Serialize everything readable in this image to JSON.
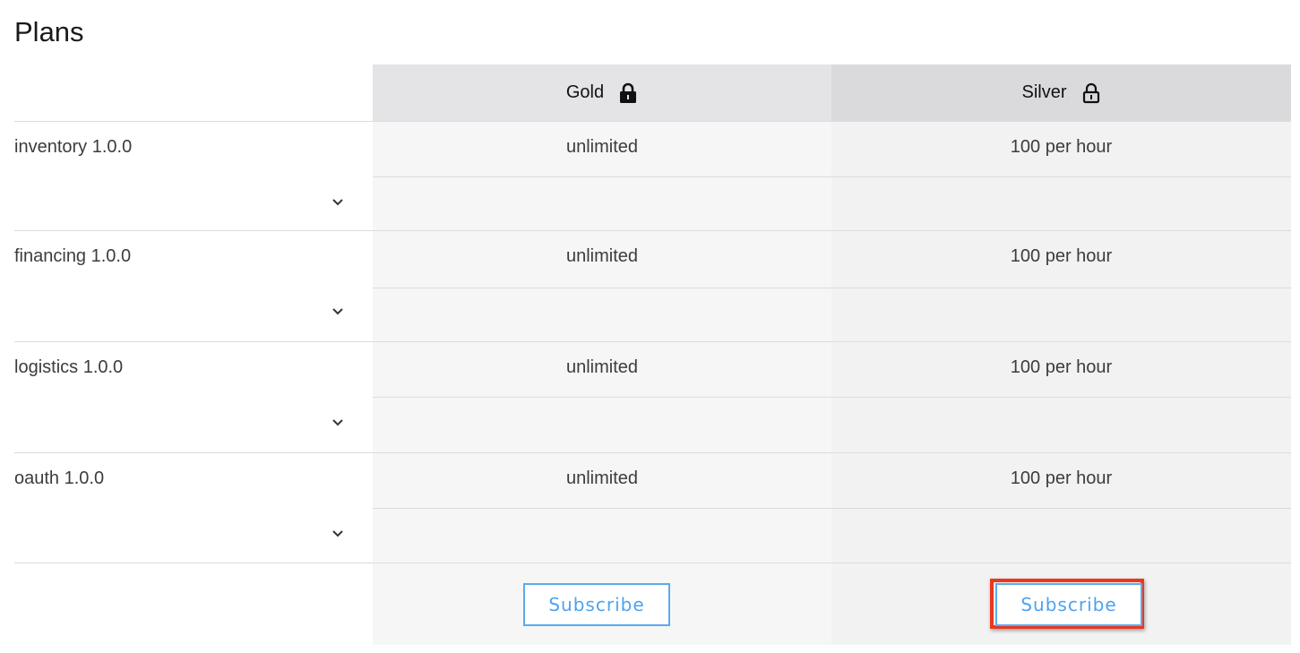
{
  "page": {
    "title": "Plans"
  },
  "plans": [
    {
      "name": "Gold",
      "lock_icon": "lock-closed-icon",
      "subscribe_label": "Subscribe"
    },
    {
      "name": "Silver",
      "lock_icon": "lock-open-icon",
      "subscribe_label": "Subscribe"
    }
  ],
  "apis": [
    {
      "name": "inventory 1.0.0",
      "gold": "unlimited",
      "silver": "100 per hour"
    },
    {
      "name": "financing 1.0.0",
      "gold": "unlimited",
      "silver": "100 per hour"
    },
    {
      "name": "logistics 1.0.0",
      "gold": "unlimited",
      "silver": "100 per hour"
    },
    {
      "name": "oauth 1.0.0",
      "gold": "unlimited",
      "silver": "100 per hour"
    }
  ],
  "colors": {
    "subscribe_accent": "#4da3f0",
    "highlight": "#e8391f"
  }
}
